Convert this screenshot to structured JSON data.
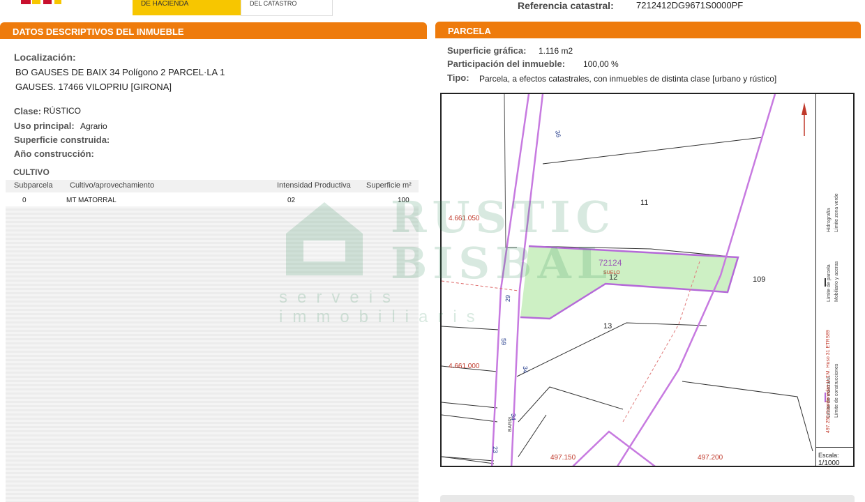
{
  "header": {
    "ministry": "DE HACIENDA",
    "catastro": "DEL CATASTRO",
    "ref_label": "Referencia catastral:",
    "ref_value": "7212412DG9671S0000PF"
  },
  "left": {
    "title": "DATOS DESCRIPTIVOS DEL INMUEBLE",
    "localizacion_label": "Localización:",
    "address_line1": "BO GAUSES DE BAIX 34 Polígono 2 PARCEL·LA  1",
    "address_line2": "GAUSES. 17466 VILOPRIU [GIRONA]",
    "clase_label": "Clase:",
    "clase_value": "RÚSTICO",
    "uso_label": "Uso principal:",
    "uso_value": "Agrario",
    "sup_label": "Superficie construida:",
    "anio_label": "Año construcción:",
    "cultivo_title": "CULTIVO",
    "columns": [
      "Subparcela",
      "Cultivo/aprovechamiento",
      "Intensidad Productiva",
      "Superficie m²"
    ],
    "rows": [
      {
        "subparcela": "0",
        "cultivo": "MT MATORRAL",
        "intensidad": "02",
        "superficie": "100"
      }
    ]
  },
  "right": {
    "title": "PARCELA",
    "sup_label": "Superficie gráfica:",
    "sup_value": "1.116 m2",
    "part_label": "Participación del inmueble:",
    "part_value": "100,00 %",
    "tipo_label": "Tipo:",
    "tipo_value": "Parcela, a efectos catastrales, con inmuebles de distinta clase [urbano y rústico]"
  },
  "map": {
    "coord_y_top": "4.661.050",
    "coord_y_bottom": "4.661.000",
    "coord_x_left": "497.150",
    "coord_x_right": "497.200",
    "parcel_ref": "72124",
    "parcel_num": "12",
    "suelo": "SUELO",
    "labels": [
      "11",
      "109",
      "13",
      "36",
      "29",
      "59",
      "34",
      "34",
      "23",
      "BARRI"
    ],
    "legend_1": "Límite de manzana",
    "legend_2": "Límite de parcela",
    "legend_3": "Hidrografía",
    "legend_4": "Límite de construcciones",
    "legend_5": "Mobiliario y aceras",
    "legend_6": "Límite zona verde",
    "utm": "497.250 Coordenadas U.T.M. Huso 31 ETRS89",
    "scale_label": "Escala:",
    "scale_value": "1/1000"
  },
  "watermark": {
    "line1": "RUSTIC",
    "line2": "BISBAL",
    "line3": "serveis immobiliaris"
  },
  "colors": {
    "orange": "#ee7b0c",
    "parcel_fill": "#cdf0c4",
    "block_line": "#c77ae0",
    "coord_red": "#c0392b"
  }
}
